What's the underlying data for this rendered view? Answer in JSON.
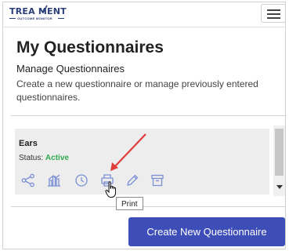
{
  "header": {
    "logo_main": "TREA MENT",
    "logo_sub": "OUTCOME MONITOR",
    "menu_icon": "hamburger-menu-icon"
  },
  "page": {
    "title": "My Questionnaires",
    "subtitle": "Manage Questionnaires",
    "description": "Create a new questionnaire or manage previously entered questionnaires."
  },
  "questionnaires": [
    {
      "name": "Ears",
      "status_label": "Status:",
      "status_value": "Active",
      "actions": [
        "share-icon",
        "chart-icon",
        "history-icon",
        "print-icon",
        "edit-icon",
        "archive-icon"
      ]
    }
  ],
  "tooltip": {
    "text": "Print"
  },
  "cta": {
    "label": "Create New Questionnaire"
  },
  "colors": {
    "brand": "#2c3f7a",
    "accent": "#3e4eb8",
    "icon": "#7b8fd4",
    "active": "#2fa84f",
    "annotation_arrow": "#e03b3b"
  }
}
